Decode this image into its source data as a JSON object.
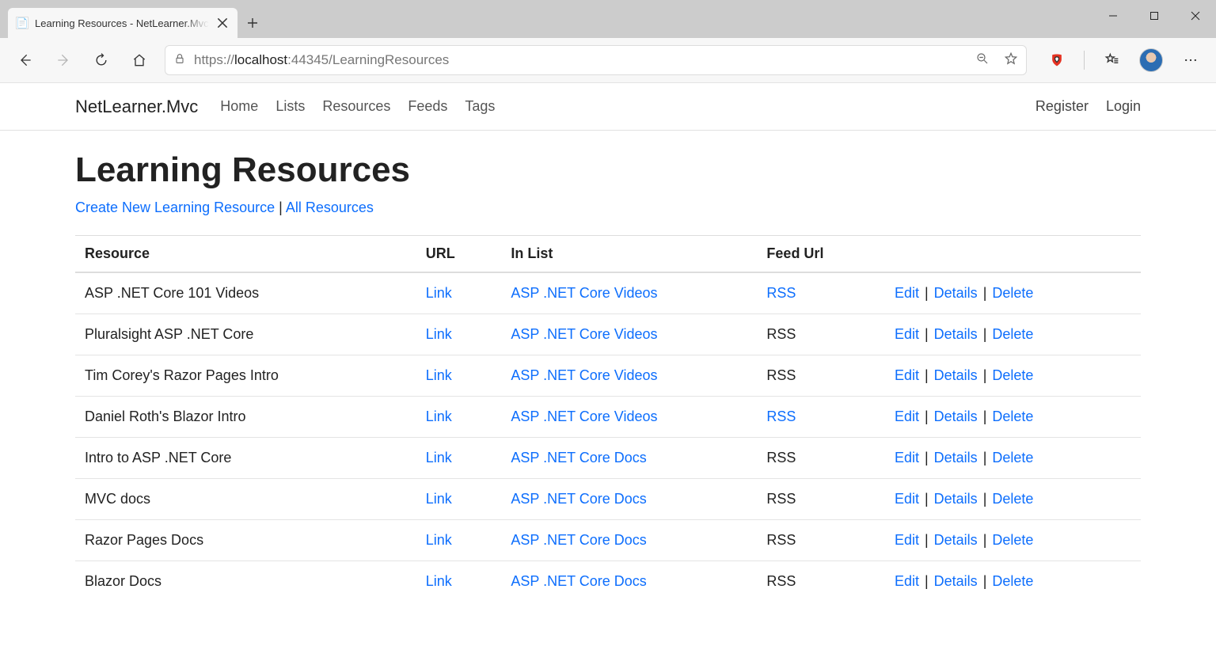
{
  "browser": {
    "tab_title": "Learning Resources - NetLearner.Mvc",
    "url_prefix": "https://",
    "url_host": "localhost",
    "url_port": ":44345",
    "url_path": "/LearningResources"
  },
  "nav": {
    "brand": "NetLearner.Mvc",
    "links": [
      "Home",
      "Lists",
      "Resources",
      "Feeds",
      "Tags"
    ],
    "right": [
      "Register",
      "Login"
    ]
  },
  "page": {
    "heading": "Learning Resources",
    "create_link": "Create New Learning Resource",
    "all_link": "All Resources",
    "separator": " | ",
    "columns": [
      "Resource",
      "URL",
      "In List",
      "Feed Url",
      ""
    ],
    "link_label": "Link",
    "actions": {
      "edit": "Edit",
      "details": "Details",
      "delete": "Delete"
    },
    "rows": [
      {
        "resource": "ASP .NET Core 101 Videos",
        "in_list": "ASP .NET Core Videos",
        "feed": "RSS",
        "feed_is_link": true
      },
      {
        "resource": "Pluralsight ASP .NET Core",
        "in_list": "ASP .NET Core Videos",
        "feed": "RSS",
        "feed_is_link": false
      },
      {
        "resource": "Tim Corey's Razor Pages Intro",
        "in_list": "ASP .NET Core Videos",
        "feed": "RSS",
        "feed_is_link": false
      },
      {
        "resource": "Daniel Roth's Blazor Intro",
        "in_list": "ASP .NET Core Videos",
        "feed": "RSS",
        "feed_is_link": true
      },
      {
        "resource": "Intro to ASP .NET Core",
        "in_list": "ASP .NET Core Docs",
        "feed": "RSS",
        "feed_is_link": false
      },
      {
        "resource": "MVC docs",
        "in_list": "ASP .NET Core Docs",
        "feed": "RSS",
        "feed_is_link": false
      },
      {
        "resource": "Razor Pages Docs",
        "in_list": "ASP .NET Core Docs",
        "feed": "RSS",
        "feed_is_link": false
      },
      {
        "resource": "Blazor Docs",
        "in_list": "ASP .NET Core Docs",
        "feed": "RSS",
        "feed_is_link": false
      }
    ]
  }
}
